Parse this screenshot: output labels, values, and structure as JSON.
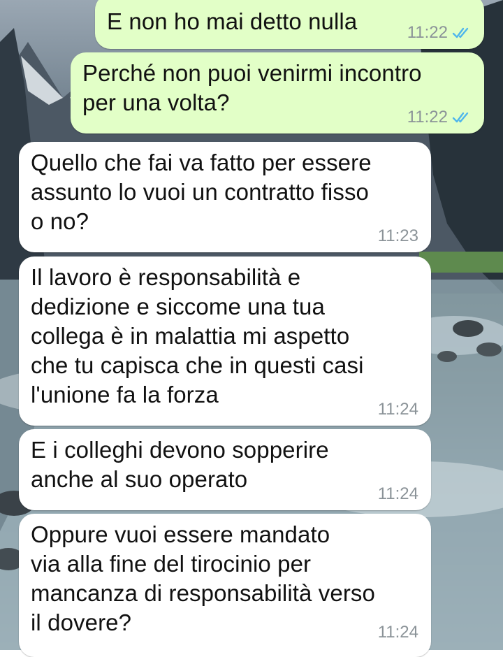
{
  "chat": {
    "messages": [
      {
        "direction": "out",
        "text": "E non ho mai detto nulla",
        "time": "11:22",
        "status": "read"
      },
      {
        "direction": "out",
        "text": "Perché non puoi venirmi incontro\nper una volta?",
        "time": "11:22",
        "status": "read"
      },
      {
        "direction": "in",
        "text": "Quello che fai va fatto per essere\nassunto lo vuoi un contratto fisso\no no?",
        "time": "11:23"
      },
      {
        "direction": "in",
        "text": "Il lavoro è responsabilità e\ndedizione e siccome una tua\ncollega è in malattia mi aspetto\nche tu capisca che in questi casi\nl'unione fa la forza",
        "time": "11:24"
      },
      {
        "direction": "in",
        "text": "E i colleghi devono sopperire\nanche al suo operato",
        "time": "11:24"
      },
      {
        "direction": "in",
        "text": "Oppure vuoi essere mandato\nvia alla fine del tirocinio per\nmancanza di responsabilità verso\nil dovere?",
        "time": "11:24"
      }
    ]
  },
  "colors": {
    "outgoing_bubble": "#e2ffc7",
    "incoming_bubble": "#ffffff",
    "read_ticks": "#4fb6ec",
    "timestamp": "#8b9398"
  },
  "icons": {
    "read_status": "double-check-icon"
  }
}
